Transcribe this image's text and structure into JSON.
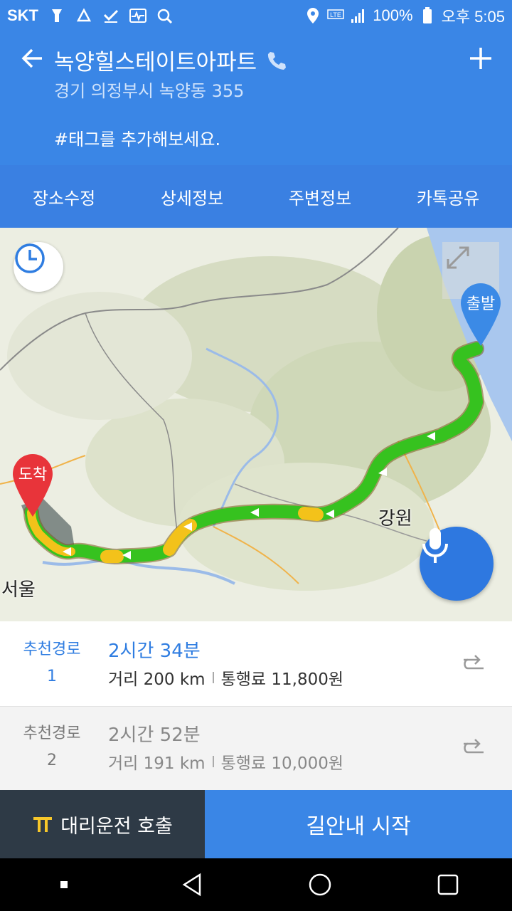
{
  "status_bar": {
    "carrier": "SKT",
    "battery": "100%",
    "time": "오후 5:05",
    "lte": "LTE"
  },
  "header": {
    "title": "녹양힐스테이트아파트",
    "address": "경기 의정부시 녹양동 355",
    "tag_hint": "#태그를 추가해보세요."
  },
  "tabs": [
    {
      "label": "장소수정"
    },
    {
      "label": "상세정보"
    },
    {
      "label": "주변정보"
    },
    {
      "label": "카톡공유"
    }
  ],
  "map": {
    "start_label": "출발",
    "end_label": "도착",
    "region_label_1": "강원",
    "region_label_2": "서울",
    "route_color": "#2fbf1f",
    "start_color": "#3b8ae6",
    "end_color": "#e8343a"
  },
  "routes": [
    {
      "rank_label": "추천경로",
      "rank_num": "1",
      "duration": "2시간 34분",
      "distance": "거리 200 km",
      "toll": "통행료 11,800원"
    },
    {
      "rank_label": "추천경로",
      "rank_num": "2",
      "duration": "2시간 52분",
      "distance": "거리 191 km",
      "toll": "통행료 10,000원"
    }
  ],
  "bottom_bar": {
    "driver_label": "대리운전 호출",
    "start_label": "길안내 시작"
  },
  "icons": {
    "back": "arrow-left-icon",
    "phone": "phone-icon",
    "add": "plus-icon",
    "clock": "clock-icon",
    "expand": "expand-icon",
    "mic": "microphone-icon",
    "route_switch": "route-switch-icon"
  }
}
